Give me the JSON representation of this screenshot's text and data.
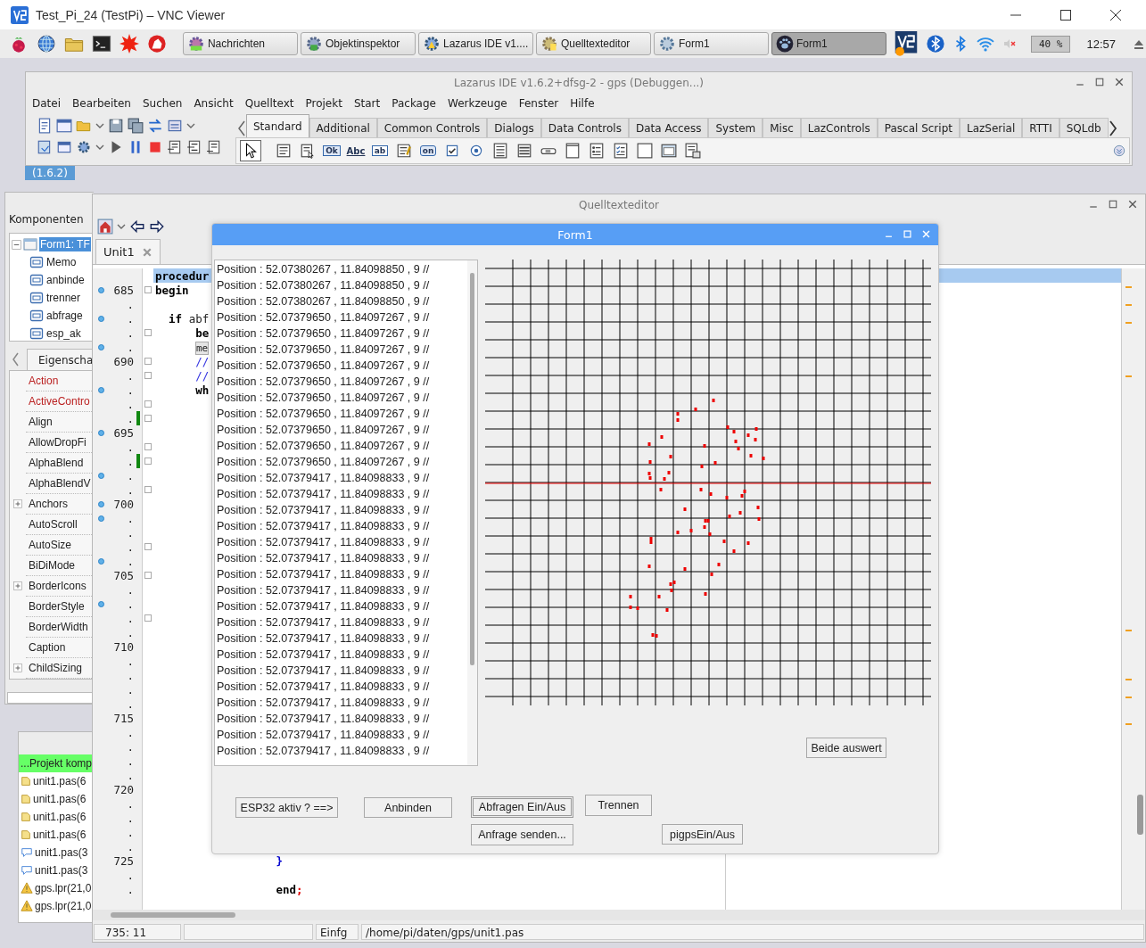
{
  "vnc_window": {
    "title": "Test_Pi_24 (TestPi) – VNC Viewer"
  },
  "taskbar": {
    "tasks": [
      {
        "label": "Nachrichten",
        "kind": "messages",
        "selected": false
      },
      {
        "label": "Objektinspektor",
        "kind": "inspector",
        "selected": false
      },
      {
        "label": "Lazarus IDE v1....",
        "kind": "ide",
        "selected": false
      },
      {
        "label": "Quelltexteditor",
        "kind": "editor",
        "selected": false
      },
      {
        "label": "Form1",
        "kind": "form",
        "selected": false
      },
      {
        "label": "Form1",
        "kind": "paw",
        "selected": true
      }
    ],
    "cpu": "40 %",
    "clock": "12:57"
  },
  "ide_window": {
    "title": "Lazarus IDE v1.6.2+dfsg-2 - gps (Debuggen...)",
    "menu": [
      "Datei",
      "Bearbeiten",
      "Suchen",
      "Ansicht",
      "Quelltext",
      "Projekt",
      "Start",
      "Package",
      "Werkzeuge",
      "Fenster",
      "Hilfe"
    ],
    "palette_tabs": [
      {
        "label": "Standard",
        "selected": true
      },
      {
        "label": "Additional",
        "selected": false
      },
      {
        "label": "Common Controls",
        "selected": false
      },
      {
        "label": "Dialogs",
        "selected": false
      },
      {
        "label": "Data Controls",
        "selected": false
      },
      {
        "label": "Data Access",
        "selected": false
      },
      {
        "label": "System",
        "selected": false
      },
      {
        "label": "Misc",
        "selected": false
      },
      {
        "label": "LazControls",
        "selected": false
      },
      {
        "label": "Pascal Script",
        "selected": false
      },
      {
        "label": "LazSerial",
        "selected": false
      },
      {
        "label": "RTTI",
        "selected": false
      },
      {
        "label": "SQLdb",
        "selected": false
      }
    ],
    "palette": [
      {
        "kind": "pointer",
        "selected": true
      },
      {
        "kind": "mainmenu",
        "selected": false
      },
      {
        "kind": "popupmenu",
        "selected": false
      },
      {
        "kind": "button",
        "glyph": "Ok",
        "selected": false
      },
      {
        "kind": "label",
        "glyph": "Abc",
        "selected": false
      },
      {
        "kind": "edit",
        "glyph": "ab",
        "selected": false
      },
      {
        "kind": "memo",
        "selected": false
      },
      {
        "kind": "toggle",
        "glyph": "on",
        "selected": false
      },
      {
        "kind": "checkbox",
        "selected": false
      },
      {
        "kind": "radio",
        "selected": false
      },
      {
        "kind": "listbox",
        "selected": false
      },
      {
        "kind": "combobox",
        "selected": false
      },
      {
        "kind": "scrollbar",
        "selected": false
      },
      {
        "kind": "groupbox",
        "selected": false
      },
      {
        "kind": "radiogroup",
        "selected": false
      },
      {
        "kind": "checkgroup",
        "selected": false
      },
      {
        "kind": "panel",
        "selected": false
      },
      {
        "kind": "frame",
        "selected": false
      },
      {
        "kind": "actionlist",
        "selected": false
      }
    ],
    "version": "(1.6.2)"
  },
  "inspector": {
    "label": "Komponenten",
    "tree": [
      {
        "label": "Form1: TF",
        "selected": true,
        "expanded": true,
        "children": [
          {
            "label": "Memo",
            "selected": false
          },
          {
            "label": "anbinde",
            "selected": false
          },
          {
            "label": "trenner",
            "selected": false
          },
          {
            "label": "abfrage",
            "selected": false
          },
          {
            "label": "esp_ak",
            "selected": false
          }
        ]
      }
    ],
    "tab": "Eigenscha",
    "properties": [
      {
        "name": "Action",
        "kind": "reference",
        "expandable": false
      },
      {
        "name": "ActiveContro",
        "kind": "reference",
        "expandable": false
      },
      {
        "name": "Align",
        "kind": "plain",
        "expandable": false
      },
      {
        "name": "AllowDropFi",
        "kind": "plain",
        "expandable": false
      },
      {
        "name": "AlphaBlend",
        "kind": "plain",
        "expandable": false
      },
      {
        "name": "AlphaBlendV",
        "kind": "plain",
        "expandable": false
      },
      {
        "name": "Anchors",
        "kind": "plain",
        "expandable": true
      },
      {
        "name": "AutoScroll",
        "kind": "plain",
        "expandable": false
      },
      {
        "name": "AutoSize",
        "kind": "plain",
        "expandable": false
      },
      {
        "name": "BiDiMode",
        "kind": "plain",
        "expandable": false
      },
      {
        "name": "BorderIcons",
        "kind": "plain",
        "expandable": true
      },
      {
        "name": "BorderStyle",
        "kind": "plain",
        "expandable": false
      },
      {
        "name": "BorderWidth",
        "kind": "plain",
        "expandable": false
      },
      {
        "name": "Caption",
        "kind": "plain",
        "expandable": false
      },
      {
        "name": "ChildSizing",
        "kind": "plain",
        "expandable": true
      }
    ]
  },
  "messages": {
    "header": "...Projekt komp",
    "items": [
      {
        "text": "unit1.pas(6",
        "kind": "note"
      },
      {
        "text": "unit1.pas(6",
        "kind": "note"
      },
      {
        "text": "unit1.pas(6",
        "kind": "note"
      },
      {
        "text": "unit1.pas(6",
        "kind": "note"
      },
      {
        "text": "unit1.pas(3",
        "kind": "hint"
      },
      {
        "text": "unit1.pas(3",
        "kind": "hint"
      },
      {
        "text": "gps.lpr(21,0",
        "kind": "warning"
      },
      {
        "text": "gps.lpr(21,0",
        "kind": "warning"
      }
    ]
  },
  "editor_window": {
    "title": "Quelltexteditor",
    "tab": "Unit1",
    "lines": [
      {
        "exec": false,
        "fold": false,
        "changed": false,
        "current": true,
        "code": [
          {
            "text": "procedur",
            "kind": "keyword"
          }
        ]
      },
      {
        "label": "685",
        "exec": true,
        "fold": true,
        "changed": false,
        "current": false,
        "code": [
          {
            "text": "begin",
            "kind": "keyword"
          }
        ]
      },
      {
        "label": ".",
        "exec": false,
        "fold": false,
        "changed": false,
        "current": false
      },
      {
        "label": ".",
        "exec": true,
        "fold": false,
        "changed": false,
        "current": false,
        "code": [
          {
            "text": "  if",
            "kind": "keyword"
          },
          {
            "text": " abf",
            "kind": "plain"
          }
        ]
      },
      {
        "label": ".",
        "exec": false,
        "fold": true,
        "changed": false,
        "current": false,
        "code": [
          {
            "text": "      be",
            "kind": "keyword"
          }
        ]
      },
      {
        "label": ".",
        "exec": true,
        "fold": false,
        "changed": false,
        "current": false,
        "code": [
          {
            "text": "me",
            "kind": "marked"
          }
        ]
      },
      {
        "label": "690",
        "exec": false,
        "fold": true,
        "changed": false,
        "current": false,
        "code": [
          {
            "text": "      //",
            "kind": "comment"
          }
        ]
      },
      {
        "label": ".",
        "exec": false,
        "fold": true,
        "changed": false,
        "current": false,
        "code": [
          {
            "text": "      //",
            "kind": "comment"
          }
        ]
      },
      {
        "label": ".",
        "exec": true,
        "fold": false,
        "changed": false,
        "current": false,
        "code": [
          {
            "text": "      wh",
            "kind": "keyword"
          }
        ]
      },
      {
        "label": ".",
        "exec": false,
        "fold": true,
        "changed": false,
        "current": false
      },
      {
        "label": ".",
        "exec": false,
        "fold": true,
        "changed": true,
        "current": false
      },
      {
        "label": "695",
        "exec": true,
        "fold": false,
        "changed": false,
        "current": false
      },
      {
        "label": ".",
        "exec": false,
        "fold": true,
        "changed": false,
        "current": false
      },
      {
        "label": ".",
        "exec": false,
        "fold": true,
        "changed": true,
        "current": false
      },
      {
        "label": ".",
        "exec": true,
        "fold": false,
        "changed": false,
        "current": false
      },
      {
        "label": ".",
        "exec": false,
        "fold": true,
        "changed": false,
        "current": false
      },
      {
        "label": "700",
        "exec": true,
        "fold": false,
        "changed": false,
        "current": false
      },
      {
        "label": ".",
        "exec": true,
        "fold": false,
        "changed": false,
        "current": false
      },
      {
        "label": ".",
        "exec": false,
        "fold": false,
        "changed": false,
        "current": false
      },
      {
        "label": ".",
        "exec": false,
        "fold": true,
        "changed": false,
        "current": false
      },
      {
        "label": ".",
        "exec": true,
        "fold": false,
        "changed": false,
        "current": false
      },
      {
        "label": "705",
        "exec": false,
        "fold": true,
        "changed": false,
        "current": false
      },
      {
        "label": ".",
        "exec": false,
        "fold": false,
        "changed": false,
        "current": false
      },
      {
        "label": ".",
        "exec": true,
        "fold": false,
        "changed": false,
        "current": false
      },
      {
        "label": ".",
        "exec": false,
        "fold": true,
        "changed": false,
        "current": false
      },
      {
        "label": ".",
        "exec": false,
        "fold": false,
        "changed": false,
        "current": false
      },
      {
        "label": "710",
        "exec": false,
        "fold": false,
        "changed": false,
        "current": false
      },
      {
        "label": ".",
        "exec": false,
        "fold": false,
        "changed": false,
        "current": false
      },
      {
        "label": ".",
        "exec": false,
        "fold": false,
        "changed": false,
        "current": false
      },
      {
        "label": ".",
        "exec": false,
        "fold": false,
        "changed": false,
        "current": false
      },
      {
        "label": ".",
        "exec": false,
        "fold": false,
        "changed": false,
        "current": false
      },
      {
        "label": "715",
        "exec": false,
        "fold": false,
        "changed": false,
        "current": false
      },
      {
        "label": ".",
        "exec": false,
        "fold": false,
        "changed": false,
        "current": false
      },
      {
        "label": ".",
        "exec": false,
        "fold": false,
        "changed": false,
        "current": false
      },
      {
        "label": ".",
        "exec": false,
        "fold": false,
        "changed": false,
        "current": false
      },
      {
        "label": ".",
        "exec": false,
        "fold": false,
        "changed": false,
        "current": false
      },
      {
        "label": "720",
        "exec": false,
        "fold": false,
        "changed": false,
        "current": false
      },
      {
        "label": ".",
        "exec": false,
        "fold": false,
        "changed": false,
        "current": false
      },
      {
        "label": ".",
        "exec": false,
        "fold": false,
        "changed": false,
        "current": false
      },
      {
        "label": ".",
        "exec": false,
        "fold": false,
        "changed": false,
        "current": false
      },
      {
        "label": ".",
        "exec": false,
        "fold": false,
        "changed": false,
        "current": false
      },
      {
        "label": "725",
        "exec": false,
        "fold": false,
        "changed": false,
        "current": false,
        "code": [
          {
            "text": "                  }",
            "kind": "brace"
          }
        ]
      },
      {
        "label": ".",
        "exec": false,
        "fold": false,
        "changed": false,
        "current": false
      },
      {
        "label": ".",
        "exec": false,
        "fold": false,
        "changed": false,
        "current": false,
        "code": [
          {
            "text": "                  end",
            "kind": "keyword"
          },
          {
            "text": ";",
            "kind": "symbol"
          }
        ]
      }
    ],
    "status": {
      "position": "735: 11",
      "mode": "Einfg",
      "file": "/home/pi/daten/gps/unit1.pas"
    }
  },
  "form_window": {
    "title": "Form1",
    "memo": [
      "Position : 52.07380267 , 11.84098850 , 9 //",
      "Position : 52.07380267 , 11.84098850 , 9 //",
      "Position : 52.07380267 , 11.84098850 , 9 //",
      "Position : 52.07379650 , 11.84097267 , 9 //",
      "Position : 52.07379650 , 11.84097267 , 9 //",
      "Position : 52.07379650 , 11.84097267 , 9 //",
      "Position : 52.07379650 , 11.84097267 , 9 //",
      "Position : 52.07379650 , 11.84097267 , 9 //",
      "Position : 52.07379650 , 11.84097267 , 9 //",
      "Position : 52.07379650 , 11.84097267 , 9 //",
      "Position : 52.07379650 , 11.84097267 , 9 //",
      "Position : 52.07379650 , 11.84097267 , 9 //",
      "Position : 52.07379650 , 11.84097267 , 9 //",
      "Position : 52.07379417 , 11.84098833 , 9 //",
      "Position : 52.07379417 , 11.84098833 , 9 //",
      "Position : 52.07379417 , 11.84098833 , 9 //",
      "Position : 52.07379417 , 11.84098833 , 9 //",
      "Position : 52.07379417 , 11.84098833 , 9 //",
      "Position : 52.07379417 , 11.84098833 , 9 //",
      "Position : 52.07379417 , 11.84098833 , 9 //",
      "Position : 52.07379417 , 11.84098833 , 9 //",
      "Position : 52.07379417 , 11.84098833 , 9 //",
      "Position : 52.07379417 , 11.84098833 , 9 //",
      "Position : 52.07379417 , 11.84098833 , 9 //",
      "Position : 52.07379417 , 11.84098833 , 9 //",
      "Position : 52.07379417 , 11.84098833 , 9 //",
      "Position : 52.07379417 , 11.84098833 , 9 //",
      "Position : 52.07379417 , 11.84098833 , 9 //",
      "Position : 52.07379417 , 11.84098833 , 9 //",
      "Position : 52.07379417 , 11.84098833 , 9 //",
      "Position : 52.07379417 , 11.84098833 , 9 //"
    ],
    "buttons": [
      {
        "label": "Beide auswert",
        "default": false
      },
      {
        "label": "ESP32 aktiv ?  ==>",
        "default": false
      },
      {
        "label": "Anbinden",
        "default": false
      },
      {
        "label": "Abfragen Ein/Aus",
        "default": true
      },
      {
        "label": "Trennen",
        "default": false
      },
      {
        "label": "Anfrage senden...",
        "default": false
      },
      {
        "label": "pigpsEin/Aus",
        "default": false
      }
    ]
  }
}
